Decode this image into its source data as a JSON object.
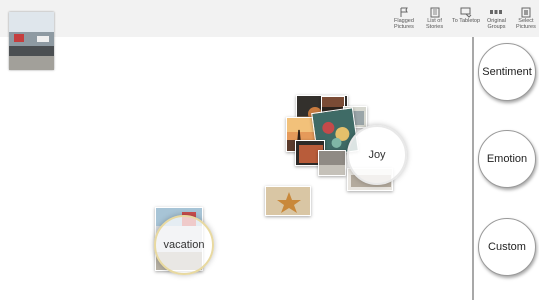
{
  "toolbar": {
    "flagged_label": "Flagged\nPictures",
    "stories_label": "List of\nStories",
    "tabletop_label": "To Tabletop",
    "groups_label": "Original\nGroups",
    "select_label": "Select\nPictures"
  },
  "side_panel": {
    "sentiment_label": "Sentiment",
    "emotion_label": "Emotion",
    "custom_label": "Custom"
  },
  "clusters": {
    "joy_label": "Joy",
    "vacation_label": "vacation"
  },
  "colors": {
    "toolbar_bg": "#f2f2f2",
    "divider": "#a8a8a8",
    "accent_ring": "#e8d9a0"
  }
}
